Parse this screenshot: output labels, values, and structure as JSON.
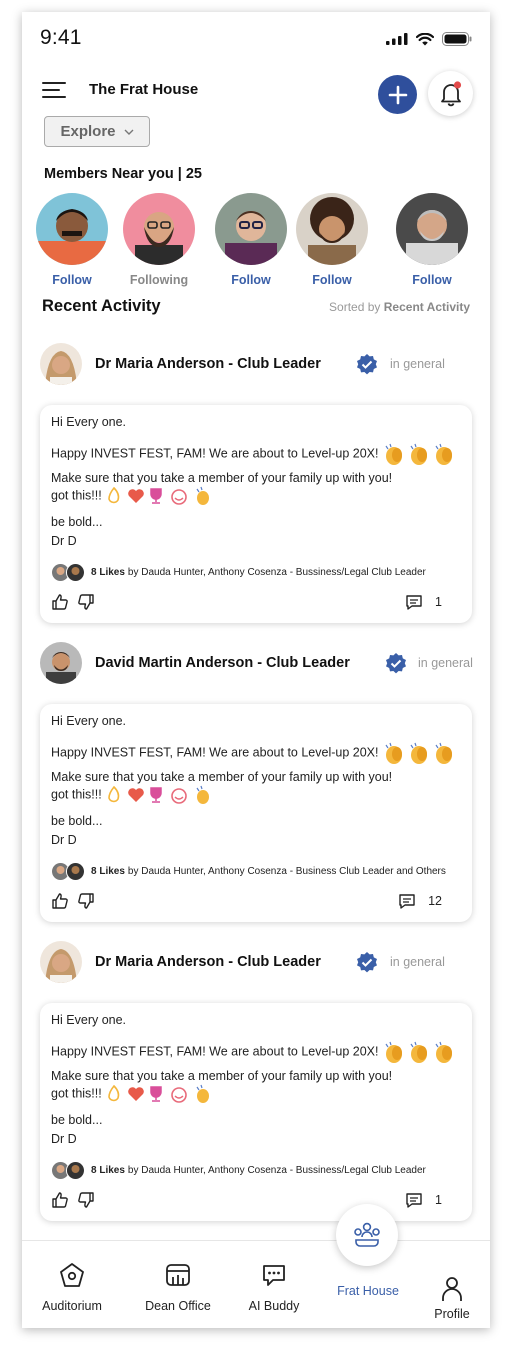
{
  "status_bar": {
    "time": "9:41"
  },
  "header": {
    "title": "The Frat House",
    "explore_label": "Explore"
  },
  "members": {
    "title": "Members Near you | 25",
    "items": [
      {
        "label": "Follow",
        "state": "follow"
      },
      {
        "label": "Following",
        "state": "following"
      },
      {
        "label": "Follow",
        "state": "follow"
      },
      {
        "label": "Follow",
        "state": "follow"
      },
      {
        "label": "Follow",
        "state": "follow"
      }
    ]
  },
  "activity": {
    "title": "Recent Activity",
    "sorted_prefix": "Sorted by",
    "sorted_value": "Recent Activity"
  },
  "posts": [
    {
      "author": "Dr Maria Anderson - Club Leader",
      "channel": "in general",
      "line1": "Hi Every one.",
      "line2": "Happy INVEST FEST, FAM! We are about to Level-up 20X!",
      "line3": "Make sure that you take a member of your family up with you!",
      "line4": "got this!!!",
      "line5": "be bold...",
      "line6": "Dr D",
      "likes_count": "8 Likes",
      "likes_by": "by Dauda Hunter, Anthony Cosenza - Bussiness/Legal Club Leader",
      "comments": "1"
    },
    {
      "author": "David Martin Anderson - Club Leader",
      "channel": "in general",
      "line1": "Hi Every one.",
      "line2": "Happy INVEST FEST, FAM! We are about to Level-up 20X!",
      "line3": "Make sure that you take a member of your family up with you!",
      "line4": "got this!!!",
      "line5": "be bold...",
      "line6": "Dr D",
      "likes_count": "8 Likes",
      "likes_by": "by Dauda Hunter, Anthony Cosenza - Business Club Leader and Others",
      "comments": "12"
    },
    {
      "author": "Dr Maria Anderson - Club Leader",
      "channel": "in general",
      "line1": "Hi Every one.",
      "line2": "Happy INVEST FEST, FAM! We are about to Level-up 20X!",
      "line3": "Make sure that you take a member of your family up with you!",
      "line4": "got this!!!",
      "line5": "be bold...",
      "line6": "Dr D",
      "likes_count": "8 Likes",
      "likes_by": "by Dauda Hunter, Anthony Cosenza - Bussiness/Legal Club Leader",
      "comments": "1"
    }
  ],
  "nav": {
    "auditorium": "Auditorium",
    "dean_office": "Dean Office",
    "ai_buddy": "AI Buddy",
    "frat_house": "Frat House",
    "profile": "Profile"
  },
  "colors": {
    "accent": "#2f4f9c",
    "link": "#3a5fa8",
    "notification_dot": "#e34b4b"
  },
  "icons": [
    "hamburger-menu-icon",
    "plus-icon",
    "bell-icon",
    "chevron-down-icon",
    "verified-badge-icon",
    "thumbs-up-icon",
    "thumbs-down-icon",
    "comment-icon",
    "auditorium-icon",
    "dean-office-icon",
    "ai-buddy-icon",
    "frat-house-icon",
    "profile-icon"
  ]
}
